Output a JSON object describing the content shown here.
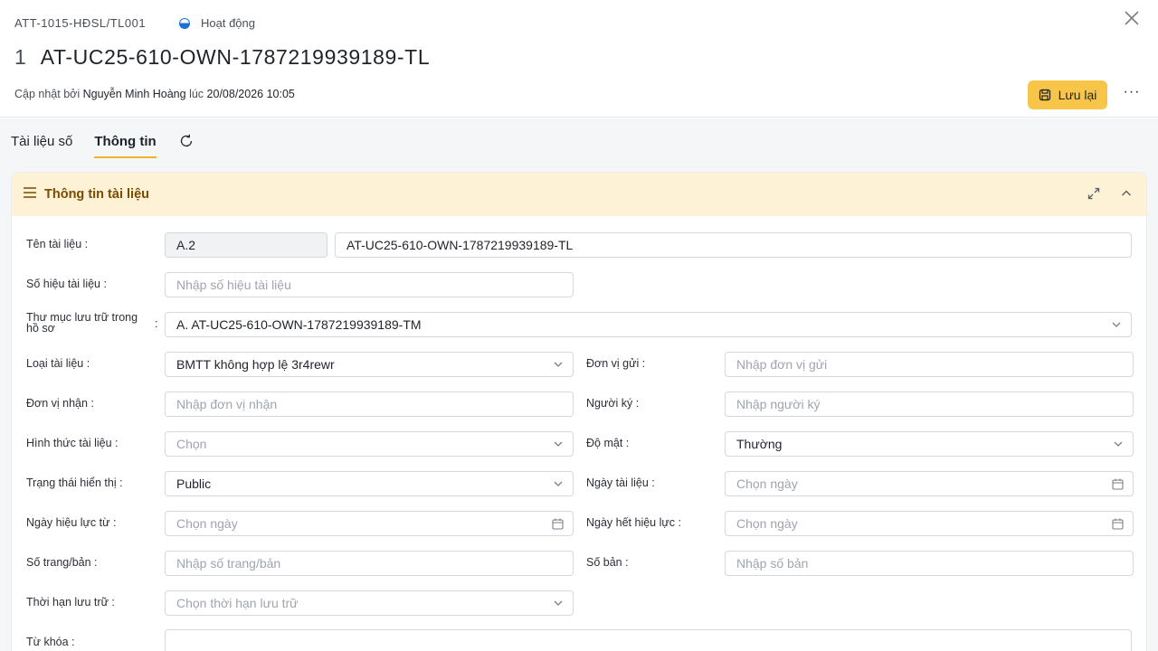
{
  "header": {
    "code": "ATT-1015-HĐSL/TL001",
    "status": "Hoạt động",
    "index": "1",
    "title": "AT-UC25-610-OWN-1787219939189-TL",
    "updated_prefix": "Cập nhật bởi",
    "updated_by": "Nguyễn Minh Hoàng",
    "updated_at_word": "lúc",
    "updated_at": "20/08/2026 10:05",
    "save_label": "Lưu lại",
    "more_label": "···",
    "close_label": "×"
  },
  "tabs": [
    {
      "label": "Tài liệu số",
      "active": false
    },
    {
      "label": "Thông tin",
      "active": true
    }
  ],
  "section": {
    "title": "Thông tin tài liệu"
  },
  "form": {
    "ten_tai_lieu": {
      "label": "Tên tài liệu :",
      "prefix": "A.2",
      "value": "AT-UC25-610-OWN-1787219939189-TL"
    },
    "so_hieu": {
      "label": "Số hiệu tài liệu :",
      "placeholder": "Nhập số hiệu tài liệu"
    },
    "thu_muc": {
      "label": "Thư mục lưu trữ trong hồ sơ",
      "colon": ":",
      "value": "A. AT-UC25-610-OWN-1787219939189-TM"
    },
    "loai_tai_lieu": {
      "label": "Loại tài liệu :",
      "value": "BMTT không hợp lệ 3r4rewr"
    },
    "don_vi_gui": {
      "label": "Đơn vị gửi :",
      "placeholder": "Nhập đơn vị gửi"
    },
    "don_vi_nhan": {
      "label": "Đơn vị nhận :",
      "placeholder": "Nhập đơn vị nhận"
    },
    "nguoi_ky": {
      "label": "Người ký :",
      "placeholder": "Nhập người ký"
    },
    "hinh_thuc": {
      "label": "Hình thức tài liệu :",
      "placeholder": "Chọn"
    },
    "do_mat": {
      "label": "Độ mật :",
      "value": "Thường"
    },
    "trang_thai": {
      "label": "Trạng thái hiển thị :",
      "value": "Public"
    },
    "ngay_tai_lieu": {
      "label": "Ngày tài liệu :",
      "placeholder": "Chọn ngày"
    },
    "hieu_luc_tu": {
      "label": "Ngày hiệu lực từ :",
      "placeholder": "Chọn ngày"
    },
    "het_hieu_luc": {
      "label": "Ngày hết hiệu lực :",
      "placeholder": "Chọn ngày"
    },
    "so_trang": {
      "label": "Số trang/bản :",
      "placeholder": "Nhập số trang/bản"
    },
    "so_ban": {
      "label": "Số bản :",
      "placeholder": "Nhập số bản"
    },
    "thoi_han": {
      "label": "Thời hạn lưu trữ :",
      "placeholder": "Chọn thời hạn lưu trữ"
    },
    "tu_khoa": {
      "label": "Từ khóa :",
      "value": ""
    }
  },
  "colors": {
    "accent": "#f7c548",
    "section_bg": "#fdf1d6",
    "section_title": "#7a4b00",
    "status_blue": "#1d6fd9"
  },
  "icons": [
    "status-half-circle-icon",
    "close-icon",
    "save-icon",
    "more-icon",
    "refresh-icon",
    "menu-icon",
    "expand-icon",
    "chevron-up-icon",
    "chevron-down-icon",
    "calendar-icon"
  ]
}
